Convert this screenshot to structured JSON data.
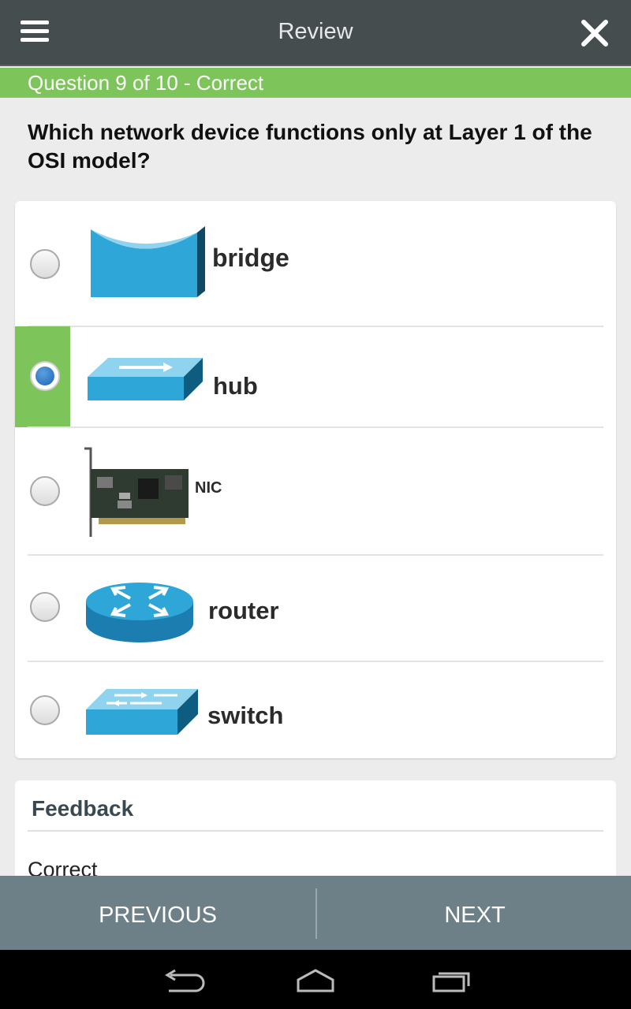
{
  "header": {
    "title": "Review"
  },
  "status": {
    "text": "Question 9 of 10 - Correct",
    "color": "#7dc55a"
  },
  "question": {
    "text": "Which network device functions only at Layer 1 of the OSI model?"
  },
  "options": [
    {
      "label": "bridge",
      "icon": "bridge-icon",
      "selected": false
    },
    {
      "label": "hub",
      "icon": "hub-icon",
      "selected": true
    },
    {
      "label": "NIC",
      "icon": "nic-card-icon",
      "selected": false
    },
    {
      "label": "router",
      "icon": "router-icon",
      "selected": false
    },
    {
      "label": "switch",
      "icon": "switch-icon",
      "selected": false
    }
  ],
  "feedback": {
    "title": "Feedback",
    "text": "Correct"
  },
  "nav": {
    "previous": "PREVIOUS",
    "next": "NEXT"
  },
  "colors": {
    "topbar": "#464d4f",
    "accent_green": "#7dc55a",
    "selected_radio": "#1f63b4",
    "bottom_nav": "#6e8087"
  }
}
